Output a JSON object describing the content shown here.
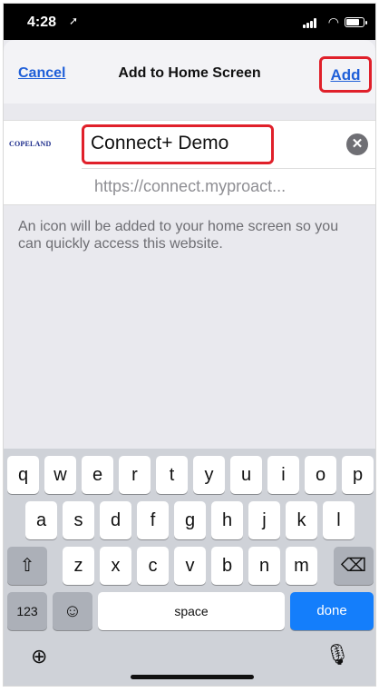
{
  "status_bar": {
    "time": "4:28",
    "location_icon": "location-arrow-icon",
    "signal_icon": "signal-icon",
    "wifi_icon": "wifi-icon",
    "battery_icon": "battery-icon"
  },
  "header": {
    "cancel_label": "Cancel",
    "title": "Add to Home Screen",
    "add_label": "Add"
  },
  "site": {
    "logo_text": "COPELAND",
    "name_value": "Connect+ Demo",
    "url": "https://connect.myproact..."
  },
  "info_text": "An icon will be added to your home screen so you can quickly access this website.",
  "keyboard": {
    "row1": [
      "q",
      "w",
      "e",
      "r",
      "t",
      "y",
      "u",
      "i",
      "o",
      "p"
    ],
    "row2": [
      "a",
      "s",
      "d",
      "f",
      "g",
      "h",
      "j",
      "k",
      "l"
    ],
    "row3": [
      "z",
      "x",
      "c",
      "v",
      "b",
      "n",
      "m"
    ],
    "numbers_label": "123",
    "space_label": "space",
    "done_label": "done"
  },
  "colors": {
    "accent": "#147efb",
    "highlight": "#e0202a",
    "link": "#1f5fd8"
  }
}
